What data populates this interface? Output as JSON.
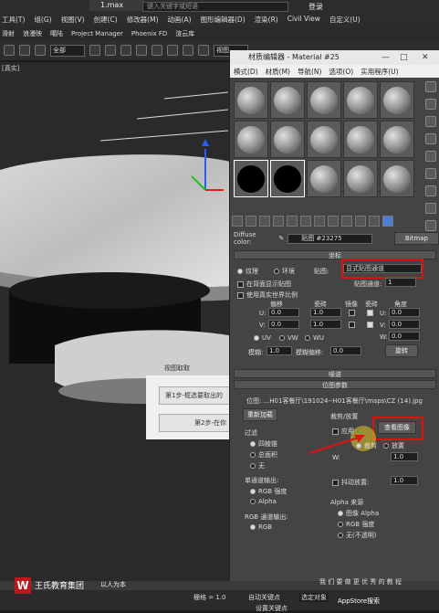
{
  "app": {
    "tab_title": "1.max",
    "search_placeholder": "键入关键字或短语",
    "account_label": "登录",
    "menu": [
      "工具(T)",
      "组(G)",
      "视图(V)",
      "创建(C)",
      "修改器(M)",
      "动画(A)",
      "图形编辑器(D)",
      "渲染(R)",
      "Civil View",
      "自定义(U)"
    ],
    "toolbar2": [
      "滑射",
      "浪漫映",
      "噶陆",
      "Project Manager",
      "Phoenix FD",
      "渲云库"
    ],
    "selection_filter": "全部",
    "view_dropdown": "视图",
    "viewport_label": "[真实]"
  },
  "material_editor": {
    "title": "材质编辑器 - Material #25",
    "menu": [
      "模式(D)",
      "材质(M)",
      "导航(N)",
      "选项(O)",
      "实用程序(U)"
    ],
    "diffuse_label": "Diffuse color:",
    "map_name": "贴图 #23275",
    "map_type": "Bitmap",
    "coords_rollout": "坐标",
    "radio_texture": "纹理",
    "radio_environment": "环境",
    "map_label": "贴图:",
    "map_channel_value": "显式贴图通道",
    "show_on_back": "在背面显示贴图",
    "real_world": "使用真实世界比例",
    "map_channel_label": "贴图通道:",
    "map_channel_num": "1",
    "headers": [
      "偏移",
      "瓷砖",
      "镜像",
      "瓷砖",
      "角度"
    ],
    "u_label": "U:",
    "v_label": "V:",
    "w_label": "W:",
    "offset_u": "0.0",
    "offset_v": "0.0",
    "tile_u": "1.0",
    "tile_v": "1.0",
    "angle_u": "0.0",
    "angle_v": "0.0",
    "angle_w": "0.0",
    "uvw": [
      "UV",
      "VW",
      "WU"
    ],
    "blur_label": "模糊:",
    "blur_value": "1.0",
    "blur_offset_label": "模糊偏移:",
    "blur_offset_value": "0.0",
    "rotate_button": "旋转",
    "noise_rollout": "噪波",
    "bitmap_params_rollout": "位图参数",
    "bitmap_path": "位图: ...H01客餐厅\\191024--H01客餐厅\\maps\\CZ (14).jpg",
    "reload_button": "重新加载",
    "crop_group": "裁剪/放置",
    "apply_label": "应用",
    "view_image_button": "查看图像",
    "crop_radio": "裁剪",
    "place_radio": "放置",
    "filter_group": "过滤",
    "filter_options": [
      "四棱锥",
      "总面积",
      "无"
    ],
    "mono_group": "单通道输出:",
    "mono_options": [
      "RGB 强度",
      "Alpha"
    ],
    "rgb_group": "RGB 通道输出:",
    "rgb_options": [
      "RGB"
    ],
    "alpha_source_group": "Alpha 来源",
    "alpha_options": [
      "图像 Alpha",
      "RGB 强度",
      "无(不透明)"
    ],
    "jitter_label": "抖动放置:",
    "jitter_value": "1.0",
    "w_val": "1.0",
    "h_val": "1.0"
  },
  "dialog": {
    "title": "视图取取",
    "step1": "第1步-框选要取出的",
    "step2": "第2步-在你"
  },
  "status": {
    "brand": "王氏教育集团",
    "brand_sub": "以人为本",
    "mode_label": "自动关键点",
    "set_key": "设置关键点",
    "sel_obj": "选定对象",
    "grid": "栅格 = 1.0",
    "appstore": "AppStore搜索",
    "watermark_text": "我 们 要 做 更 优 秀 的 教 程"
  }
}
